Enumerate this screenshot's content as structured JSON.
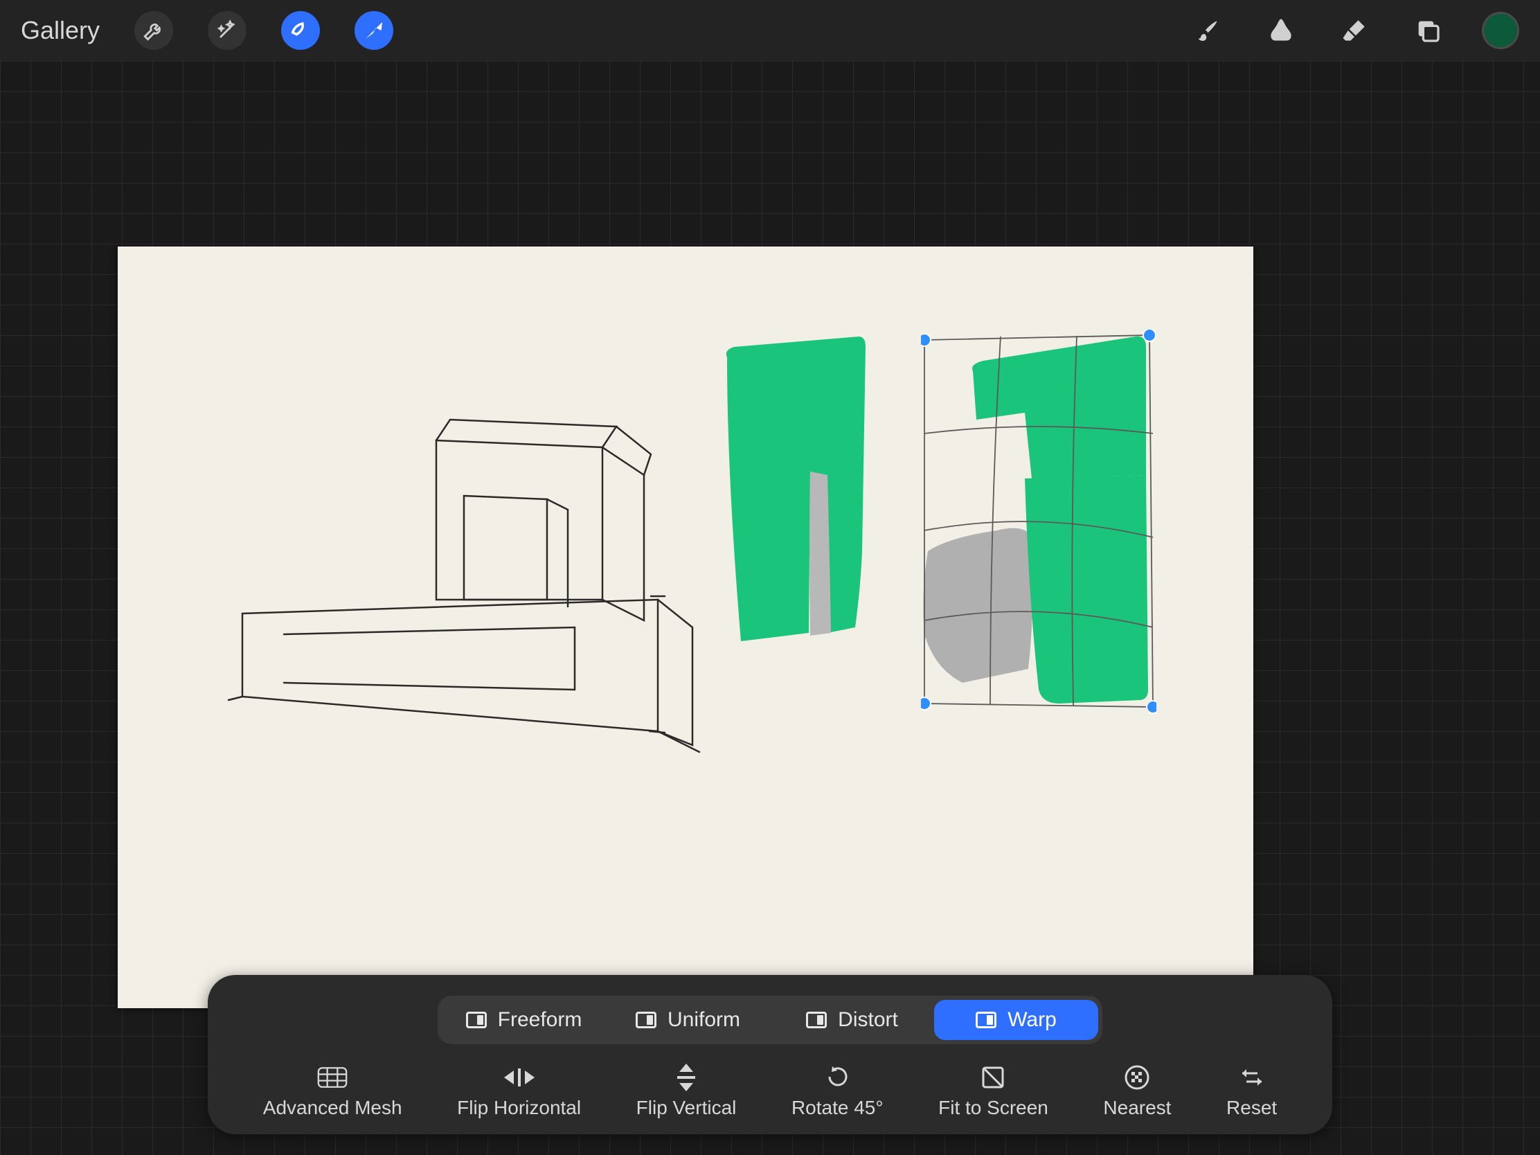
{
  "toolbar": {
    "gallery": "Gallery"
  },
  "transform_modes": {
    "freeform": "Freeform",
    "uniform": "Uniform",
    "distort": "Distort",
    "warp": "Warp",
    "selected": "warp"
  },
  "transform_actions": {
    "advanced_mesh": "Advanced Mesh",
    "flip_horizontal": "Flip Horizontal",
    "flip_vertical": "Flip Vertical",
    "rotate_45": "Rotate 45°",
    "fit_to_screen": "Fit to Screen",
    "nearest": "Nearest",
    "reset": "Reset"
  },
  "colors": {
    "accent_blue": "#2f6fff",
    "swatch": "#0d5a3b",
    "paint_green": "#1ac47a"
  }
}
